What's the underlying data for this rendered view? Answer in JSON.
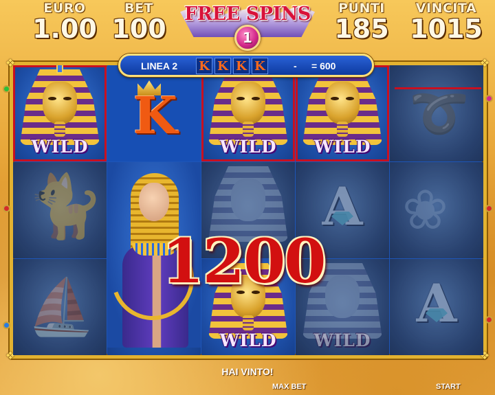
{
  "hud": {
    "euro": {
      "label": "EURO",
      "value": "1.00"
    },
    "bet": {
      "label": "BET",
      "value": "100"
    },
    "punti": {
      "label": "PUNTI",
      "value": "185"
    },
    "vincita": {
      "label": "VINCITA",
      "value": "1015"
    },
    "free_spins": {
      "label": "FREE SPINS",
      "count": "1"
    }
  },
  "win_line": {
    "label": "LINEA 2",
    "symbols": [
      "K",
      "K",
      "K",
      "K"
    ],
    "dash": "-",
    "amount": "= 600"
  },
  "reels": {
    "win_amount": "1200",
    "wild_label": "WILD",
    "k_label": "K",
    "a_label": "A"
  },
  "footer": {
    "message": "HAI VINTO!",
    "max_bet": "MAX BET",
    "start": "START"
  },
  "colors": {
    "frame_gold": "#e3b230",
    "reel_blue": "#1e56b8",
    "win_red": "#d21010"
  }
}
